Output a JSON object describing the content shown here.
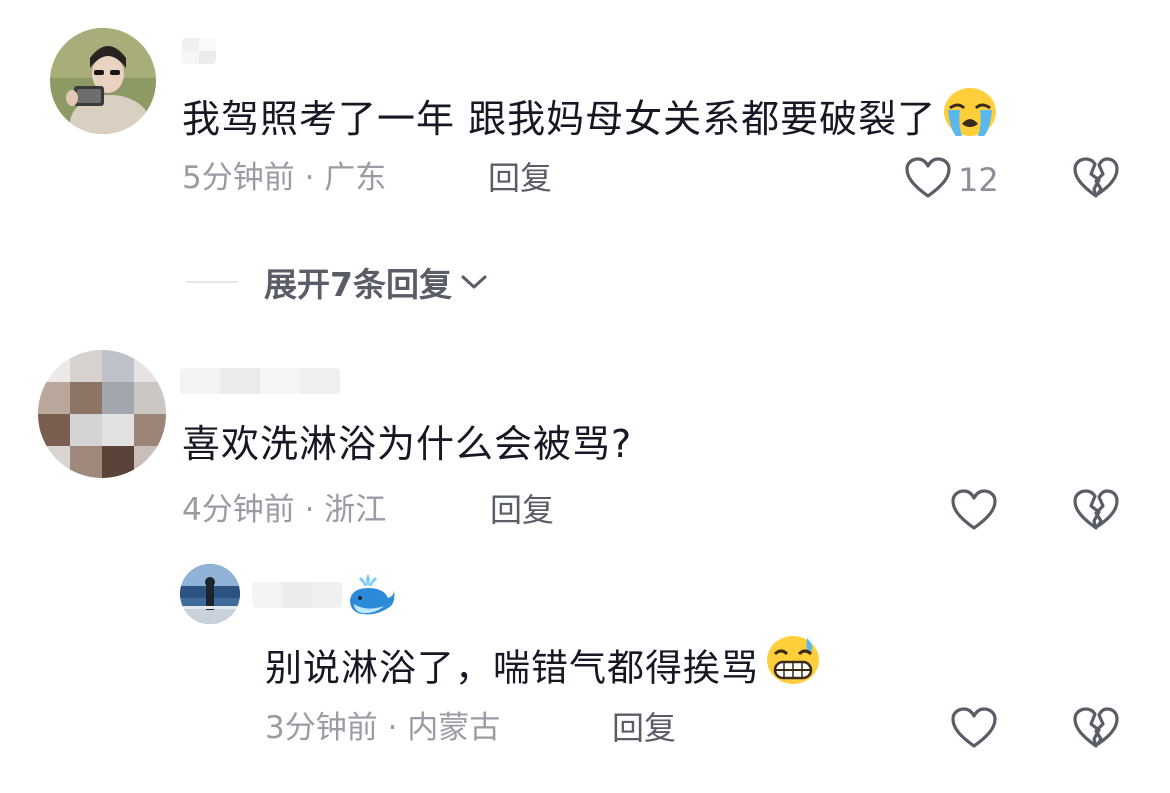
{
  "comments": [
    {
      "text": "我驾照考了一年 跟我妈母女关系都要破裂了",
      "emoji": "loudly-crying-face",
      "time": "5分钟前",
      "location": "· 广东",
      "reply_label": "回复",
      "like_count": "12",
      "expand_label": "展开7条回复"
    },
    {
      "text": "喜欢洗淋浴为什么会被骂?",
      "time": "4分钟前",
      "location": "· 浙江",
      "reply_label": "回复",
      "like_count": ""
    }
  ],
  "reply": {
    "text": "别说淋浴了，喘错气都得挨骂",
    "emoji": "grinning-face-with-sweat",
    "username_badge": "spouting-whale",
    "time": "3分钟前",
    "location": "· 内蒙古",
    "reply_label": "回复",
    "like_count": ""
  },
  "colors": {
    "text": "#161823",
    "meta": "#9a9ca3",
    "action": "#5a5d66",
    "icon": "#5a5d66"
  }
}
